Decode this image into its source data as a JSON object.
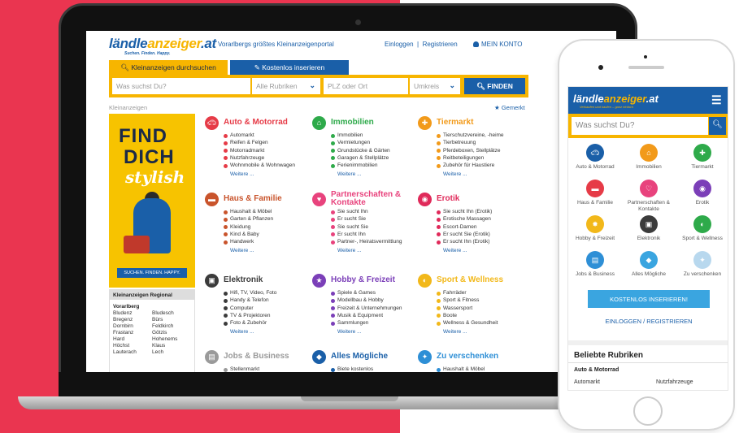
{
  "site": {
    "logo_main": "ländle",
    "logo_hl": "anzeiger",
    "logo_tld": ".at",
    "logo_sub": "Suchen. Finden. Happy.",
    "tagline": "Vorarlbergs größtes Kleinanzeigenportal",
    "login": "Einloggen",
    "sep": "|",
    "register": "Registrieren",
    "account": "MEIN KONTO"
  },
  "tabs": {
    "search": "Kleinanzeigen durchsuchen",
    "insert": "Kostenlos inserieren"
  },
  "search": {
    "query_placeholder": "Was suchst Du?",
    "category": "Alle Rubriken",
    "location_placeholder": "PLZ oder Ort",
    "radius": "Umkreis",
    "button": "FINDEN"
  },
  "breadcrumb": "Kleinanzeigen",
  "favorites": "Gemerkt",
  "ad": {
    "line1": "FIND",
    "line2": "DICH",
    "line3": "stylish",
    "button": "SUCHEN. FINDEN. HAPPY."
  },
  "regional": {
    "title": "Kleinanzeigen Regional",
    "region": "Vorarlberg",
    "towns": [
      "Bludenz",
      "Bludesch",
      "Bregenz",
      "Bürs",
      "Dornbirn",
      "Feldkirch",
      "Frastanz",
      "Götzis",
      "Hard",
      "Hohenems",
      "Höchst",
      "Klaus",
      "Lauterach",
      "Lech"
    ]
  },
  "categories": [
    {
      "title": "Auto & Motorrad",
      "color": "#e63b47",
      "items": [
        "Automarkt",
        "Reifen & Felgen",
        "Motorradmarkt",
        "Nutzfahrzeuge",
        "Wohnmobile & Wohnwagen"
      ],
      "more": "Weitere ..."
    },
    {
      "title": "Immobilien",
      "color": "#2eaa4a",
      "items": [
        "Immobilien",
        "Vermietungen",
        "Grundstücke & Gärten",
        "Garagen & Stellplätze",
        "Ferienimmobilien"
      ],
      "more": "Weitere ..."
    },
    {
      "title": "Tiermarkt",
      "color": "#f29a1a",
      "items": [
        "Tierschutzvereine, -heime",
        "Tierbetreuung",
        "Pferdeboxen, Stellplätze",
        "Reitbeteiligungen",
        "Zubehör für Haustiere"
      ],
      "more": "Weitere ..."
    },
    {
      "title": "Haus & Familie",
      "color": "#c9542c",
      "items": [
        "Haushalt & Möbel",
        "Garten & Pflanzen",
        "Kleidung",
        "Kind & Baby",
        "Handwerk"
      ],
      "more": "Weitere ..."
    },
    {
      "title": "Partnerschaften & Kontakte",
      "color": "#e8437d",
      "items": [
        "Sie sucht Ihn",
        "Er sucht Sie",
        "Sie sucht Sie",
        "Er sucht Ihn",
        "Partner-, Heiratsvermittlung"
      ],
      "more": "Weitere ..."
    },
    {
      "title": "Erotik",
      "color": "#e02a5a",
      "items": [
        "Sie sucht Ihn (Erotik)",
        "Erotische Massagen",
        "Escort-Damen",
        "Er sucht Sie (Erotik)",
        "Er sucht Ihn (Erotik)"
      ],
      "more": "Weitere ..."
    },
    {
      "title": "Elektronik",
      "color": "#3b3b3b",
      "items": [
        "Hifi, TV, Video, Foto",
        "Handy & Telefon",
        "Computer",
        "TV & Projektoren",
        "Foto & Zubehör"
      ],
      "more": "Weitere ..."
    },
    {
      "title": "Hobby & Freizeit",
      "color": "#7b3fb8",
      "items": [
        "Spiele & Games",
        "Modellbau & Hobby",
        "Freizeit & Unternehmungen",
        "Musik & Equipment",
        "Sammlungen"
      ],
      "more": "Weitere ..."
    },
    {
      "title": "Sport & Wellness",
      "color": "#f2b81a",
      "items": [
        "Fahrräder",
        "Sport & Fitness",
        "Wassersport",
        "Boote",
        "Wellness & Gesundheit"
      ],
      "more": "Weitere ..."
    },
    {
      "title": "Jobs & Business",
      "color": "#9a9a9a",
      "items": [
        "Stellenmarkt"
      ],
      "more": ""
    },
    {
      "title": "Alles Mögliche",
      "color": "#1a5fa8",
      "items": [
        "Biete kostenlos"
      ],
      "more": ""
    },
    {
      "title": "Zu verschenken",
      "color": "#2e8fd6",
      "items": [
        "Haushalt & Möbel"
      ],
      "more": ""
    }
  ],
  "mobile": {
    "logo_main": "ländle",
    "logo_hl": "anzeiger",
    "logo_tld": ".at",
    "logo_sub": "Verkaufen und kaufen – ganz einfach",
    "search_placeholder": "Was suchst Du?",
    "grid": [
      {
        "label": "Auto & Motorrad",
        "color": "#1a5fa8"
      },
      {
        "label": "Immobilien",
        "color": "#f29a1a"
      },
      {
        "label": "Tiermarkt",
        "color": "#2eaa4a"
      },
      {
        "label": "Haus & Familie",
        "color": "#e63b47"
      },
      {
        "label": "Partnerschaften & Kontakte",
        "color": "#e8437d"
      },
      {
        "label": "Erotik",
        "color": "#7b3fb8"
      },
      {
        "label": "Hobby & Freizeit",
        "color": "#f2b81a"
      },
      {
        "label": "Elektronik",
        "color": "#3b3b3b"
      },
      {
        "label": "Sport & Wellness",
        "color": "#2eaa4a"
      },
      {
        "label": "Jobs & Business",
        "color": "#2e8fd6"
      },
      {
        "label": "Alles Mögliche",
        "color": "#3aa5e0"
      },
      {
        "label": "Zu verschenken",
        "color": "#b8d8ee"
      }
    ],
    "cta": "KOSTENLOS INSERIEREN!",
    "login": "EINLOGGEN / REGISTRIEREN",
    "popular_title": "Beliebte Rubriken",
    "popular_sub": "Auto & Motorrad",
    "popular_items": [
      "Automarkt",
      "Nutzfahrzeuge"
    ]
  },
  "colors": {
    "brand_blue": "#1a5fa8",
    "brand_yellow": "#f7b500",
    "background_red": "#ea3550"
  }
}
